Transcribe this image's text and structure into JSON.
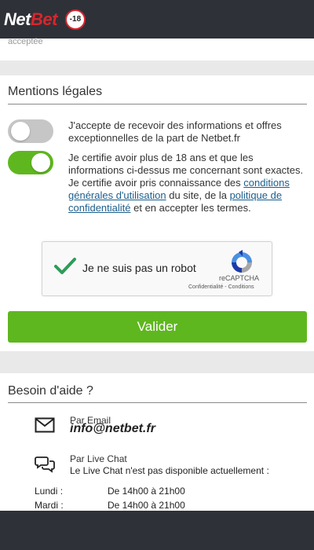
{
  "header": {
    "logo_part1": "Net",
    "logo_part2": "Bet",
    "age_badge": "-18"
  },
  "top_card": {
    "faded_text": "acceptée"
  },
  "legal": {
    "title": "Mentions légales",
    "consent_marketing": {
      "checked": false,
      "text": "J'accepte de recevoir des informations et offres exceptionnelles de la part de Netbet.fr"
    },
    "consent_age": {
      "checked": true,
      "text_1": "Je certifie avoir plus de 18 ans et que les informations ci-dessus me concernant sont exactes. Je certifie avoir pris connaissance des ",
      "link_terms": "conditions générales d'utilisation",
      "text_2": " du site, de la ",
      "link_privacy": "politique de confidentialité",
      "text_3": " et en accepter les termes."
    },
    "captcha": {
      "label": "Je ne suis pas un robot",
      "brand": "reCAPTCHA",
      "links": "Confidentialité - Conditions",
      "checked": true
    },
    "validate_label": "Valider"
  },
  "help": {
    "title": "Besoin d'aide ?",
    "email_label": "Par Email",
    "email": "info@netbet.fr",
    "chat_label": "Par Live Chat",
    "chat_status": "Le Live Chat n'est pas disponible actuellement :",
    "hours": [
      {
        "day": "Lundi :",
        "time": "De 14h00 à 21h00"
      },
      {
        "day": "Mardi :",
        "time": "De 14h00 à 21h00"
      }
    ]
  },
  "colors": {
    "header_bg": "#2f3138",
    "brand_red": "#d7262c",
    "accent_green": "#5fb71f",
    "link_blue": "#1b5e8c",
    "page_bg": "#e9e9e9"
  },
  "icons": [
    "age-restriction-icon",
    "checkmark-icon",
    "recaptcha-logo-icon",
    "envelope-icon",
    "chat-bubbles-icon"
  ]
}
